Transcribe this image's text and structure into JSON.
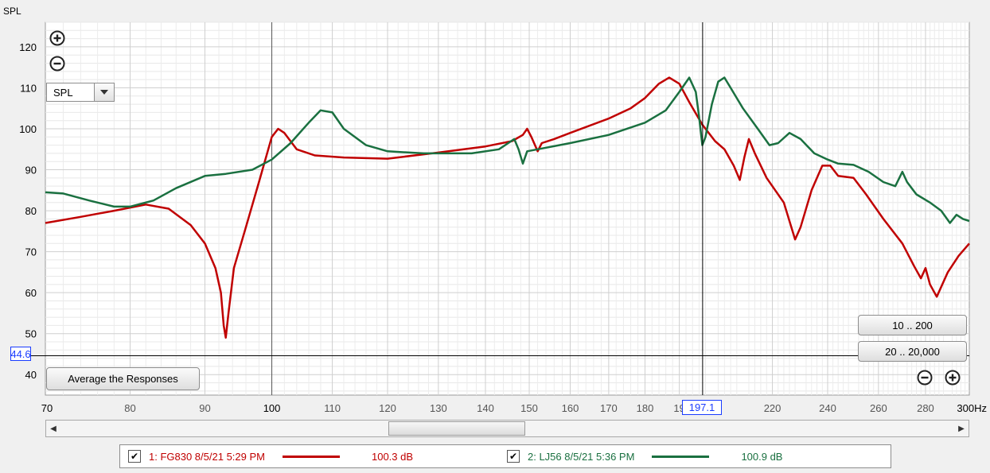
{
  "chart_data": {
    "type": "line",
    "ylabel": "SPL",
    "xunit": "Hz",
    "xscale": "log",
    "xlim": [
      70,
      300
    ],
    "ylim": [
      35,
      126
    ],
    "yticks": [
      40,
      50,
      60,
      70,
      80,
      90,
      100,
      110,
      120
    ],
    "xticks": [
      {
        "v": 70,
        "label": "70",
        "major": true
      },
      {
        "v": 80,
        "label": "80",
        "major": false
      },
      {
        "v": 90,
        "label": "90",
        "major": false
      },
      {
        "v": 100,
        "label": "100",
        "major": true
      },
      {
        "v": 110,
        "label": "110",
        "major": false
      },
      {
        "v": 120,
        "label": "120",
        "major": false
      },
      {
        "v": 130,
        "label": "130",
        "major": false
      },
      {
        "v": 140,
        "label": "140",
        "major": false
      },
      {
        "v": 150,
        "label": "150",
        "major": false
      },
      {
        "v": 160,
        "label": "160",
        "major": false
      },
      {
        "v": 170,
        "label": "170",
        "major": false
      },
      {
        "v": 180,
        "label": "180",
        "major": false
      },
      {
        "v": 190,
        "label": "19",
        "major": false
      },
      {
        "v": 220,
        "label": "220",
        "major": false
      },
      {
        "v": 240,
        "label": "240",
        "major": false
      },
      {
        "v": 260,
        "label": "260",
        "major": false
      },
      {
        "v": 280,
        "label": "280",
        "major": false
      },
      {
        "v": 300,
        "label": "300Hz",
        "major": true
      }
    ],
    "cursor": {
      "x": 197.1,
      "x_label": "197.1",
      "y": 44.6,
      "y_label": "44.6"
    },
    "grid": true,
    "series": [
      {
        "name": "1: FG830 8/5/21 5:29 PM",
        "color": "#c00000",
        "value_label": "100.3 dB",
        "points": [
          [
            70,
            77
          ],
          [
            74,
            78.5
          ],
          [
            78,
            80
          ],
          [
            82,
            81.5
          ],
          [
            85,
            80.5
          ],
          [
            88,
            76.5
          ],
          [
            90,
            72
          ],
          [
            91.5,
            66
          ],
          [
            92.3,
            60
          ],
          [
            92.7,
            52
          ],
          [
            93.0,
            49
          ],
          [
            93.4,
            55
          ],
          [
            94.2,
            66
          ],
          [
            96,
            76
          ],
          [
            98,
            87
          ],
          [
            100,
            98
          ],
          [
            101,
            100
          ],
          [
            102,
            99
          ],
          [
            104,
            95
          ],
          [
            107,
            93.5
          ],
          [
            112,
            93
          ],
          [
            120,
            92.7
          ],
          [
            130,
            94.2
          ],
          [
            140,
            95.7
          ],
          [
            146,
            97
          ],
          [
            148.5,
            98.5
          ],
          [
            149.5,
            100
          ],
          [
            150.5,
            98
          ],
          [
            152,
            94.5
          ],
          [
            153,
            96.5
          ],
          [
            156,
            97.5
          ],
          [
            160,
            99
          ],
          [
            170,
            102.5
          ],
          [
            176,
            105
          ],
          [
            180,
            107.5
          ],
          [
            184,
            111
          ],
          [
            187,
            112.5
          ],
          [
            190,
            111
          ],
          [
            193,
            106.5
          ],
          [
            197,
            101
          ],
          [
            201,
            97
          ],
          [
            204,
            95
          ],
          [
            207,
            91
          ],
          [
            209,
            87.5
          ],
          [
            210.5,
            93
          ],
          [
            212,
            97.5
          ],
          [
            214,
            94
          ],
          [
            218,
            88
          ],
          [
            224,
            82
          ],
          [
            228,
            73
          ],
          [
            230,
            76
          ],
          [
            234,
            85
          ],
          [
            238,
            91
          ],
          [
            241,
            91
          ],
          [
            244,
            88.5
          ],
          [
            250,
            88
          ],
          [
            255,
            84
          ],
          [
            262,
            78
          ],
          [
            270,
            72
          ],
          [
            275,
            66.5
          ],
          [
            278,
            63.5
          ],
          [
            280,
            66
          ],
          [
            282,
            62
          ],
          [
            285,
            59
          ],
          [
            290,
            65
          ],
          [
            295,
            69
          ],
          [
            300,
            72
          ]
        ]
      },
      {
        "name": "2: LJ56 8/5/21 5:36 PM",
        "color": "#1a7040",
        "value_label": "100.9 dB",
        "points": [
          [
            70,
            84.5
          ],
          [
            72,
            84.2
          ],
          [
            75,
            82.5
          ],
          [
            78,
            81
          ],
          [
            80,
            81
          ],
          [
            83,
            82.5
          ],
          [
            86,
            85.5
          ],
          [
            90,
            88.5
          ],
          [
            93,
            89
          ],
          [
            97,
            90
          ],
          [
            100,
            92.5
          ],
          [
            103,
            96.5
          ],
          [
            106,
            101.5
          ],
          [
            108,
            104.5
          ],
          [
            110,
            104
          ],
          [
            112,
            100
          ],
          [
            116,
            96
          ],
          [
            120,
            94.5
          ],
          [
            127,
            94
          ],
          [
            137,
            94
          ],
          [
            143,
            95
          ],
          [
            146.5,
            97.5
          ],
          [
            147.5,
            95
          ],
          [
            148.5,
            91.5
          ],
          [
            149.5,
            94.5
          ],
          [
            152,
            95
          ],
          [
            160,
            96.5
          ],
          [
            170,
            98.5
          ],
          [
            180,
            101.5
          ],
          [
            186,
            104.5
          ],
          [
            190,
            109
          ],
          [
            193,
            112.5
          ],
          [
            195,
            109
          ],
          [
            196,
            103
          ],
          [
            197,
            96
          ],
          [
            198,
            98
          ],
          [
            200,
            106
          ],
          [
            202,
            111.5
          ],
          [
            204,
            112.5
          ],
          [
            206,
            110
          ],
          [
            210,
            105
          ],
          [
            215,
            100
          ],
          [
            219,
            96
          ],
          [
            222,
            96.5
          ],
          [
            226,
            99
          ],
          [
            230,
            97.5
          ],
          [
            235,
            94
          ],
          [
            240,
            92.5
          ],
          [
            244,
            91.5
          ],
          [
            250,
            91.2
          ],
          [
            256,
            89.5
          ],
          [
            262,
            87
          ],
          [
            267,
            86
          ],
          [
            270,
            89.5
          ],
          [
            272,
            87
          ],
          [
            276,
            84
          ],
          [
            282,
            82
          ],
          [
            287,
            80
          ],
          [
            291,
            77
          ],
          [
            294,
            79
          ],
          [
            297,
            78
          ],
          [
            300,
            77.5
          ]
        ]
      }
    ]
  },
  "controls": {
    "zoom_in_icon": "plus-circle-icon",
    "zoom_out_icon": "minus-circle-icon",
    "spl_select_value": "SPL",
    "average_button": "Average the Responses",
    "range_button_1": "10 .. 200",
    "range_button_2": "20 .. 20,000"
  },
  "legend": {
    "items": [
      {
        "checked": true,
        "label": "1: FG830 8/5/21 5:29 PM",
        "value": "100.3 dB",
        "color": "#c00000"
      },
      {
        "checked": true,
        "label": "2: LJ56 8/5/21 5:36 PM",
        "value": "100.9 dB",
        "color": "#1a7040"
      }
    ]
  }
}
